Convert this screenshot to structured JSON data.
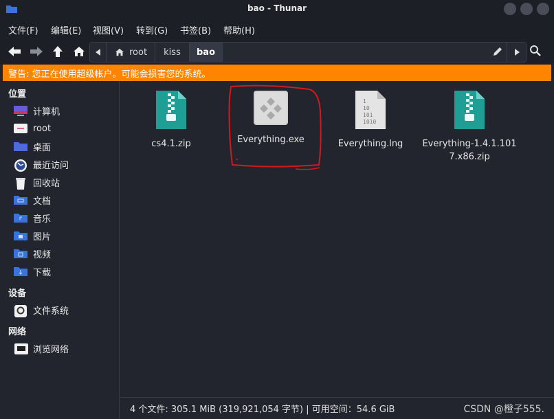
{
  "window": {
    "title": "bao - Thunar"
  },
  "menu": [
    "文件(F)",
    "编辑(E)",
    "视图(V)",
    "转到(G)",
    "书签(B)",
    "帮助(H)"
  ],
  "path": {
    "crumbs": [
      "root",
      "kiss",
      "bao"
    ],
    "active": "bao"
  },
  "warning": "警告: 您正在使用超级帐户。可能会损害您的系统。",
  "sidebar": {
    "places_heading": "位置",
    "places": [
      {
        "label": "计算机",
        "icon": "computer-icon"
      },
      {
        "label": "root",
        "icon": "home-folder-icon"
      },
      {
        "label": "桌面",
        "icon": "desktop-icon"
      },
      {
        "label": "最近访问",
        "icon": "recent-icon"
      },
      {
        "label": "回收站",
        "icon": "trash-icon"
      },
      {
        "label": "文档",
        "icon": "documents-folder-icon"
      },
      {
        "label": "音乐",
        "icon": "music-folder-icon"
      },
      {
        "label": "图片",
        "icon": "pictures-folder-icon"
      },
      {
        "label": "视频",
        "icon": "videos-folder-icon"
      },
      {
        "label": "下载",
        "icon": "downloads-folder-icon"
      }
    ],
    "devices_heading": "设备",
    "devices": [
      {
        "label": "文件系统",
        "icon": "drive-icon"
      }
    ],
    "network_heading": "网络",
    "network": [
      {
        "label": "浏览网络",
        "icon": "network-icon"
      }
    ]
  },
  "files": [
    {
      "name": "cs4.1.zip",
      "icon": "zip-archive-icon"
    },
    {
      "name": "Everything.exe",
      "icon": "executable-icon"
    },
    {
      "name": "Everything.lng",
      "icon": "binary-file-icon"
    },
    {
      "name": "Everything-1.4.1.1017.x86.zip",
      "icon": "zip-archive-icon"
    }
  ],
  "status": "4 个文件: 305.1 MiB (319,921,054 字节) | 可用空间：54.6 GiB",
  "watermark": "CSDN @橙子555.",
  "colors": {
    "warning": "#ff8400",
    "zip": "#1f9e96",
    "annotation": "#d11a1a",
    "folder": "#3a73d9"
  }
}
